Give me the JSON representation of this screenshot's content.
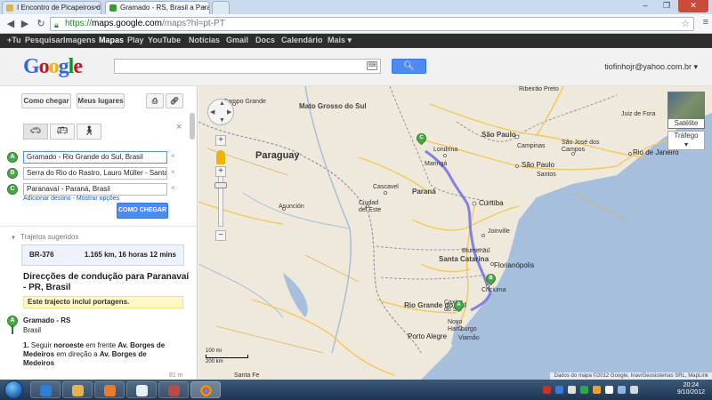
{
  "browser": {
    "tabs": [
      {
        "title": "I Encontro de Picapeiros d",
        "fav_color": "#d9b54a"
      },
      {
        "title": "Gramado - RS, Brasil a Para",
        "fav_color": "#3a9a3a"
      }
    ],
    "url": {
      "scheme": "https://",
      "host": "maps.google.com",
      "path": "/maps?hl=pt-PT"
    }
  },
  "gbar": {
    "items": [
      "+Tu",
      "Pesquisar",
      "Imagens",
      "Mapas",
      "Play",
      "YouTube",
      "Notícias",
      "Gmail",
      "Docs",
      "Calendário",
      "Mais"
    ],
    "active": "Mapas"
  },
  "header": {
    "logo": "Google",
    "search_placeholder": "",
    "user": "tiofinhojr@yahoo.com.br"
  },
  "panel": {
    "get_directions": "Como chegar",
    "my_places": "Meus lugares",
    "waypoints": [
      {
        "letter": "A",
        "value": "Gramado - Rio Grande do Sul, Brasil"
      },
      {
        "letter": "B",
        "value": "Serra do Rio do Rastro, Lauro Müller - Santa C"
      },
      {
        "letter": "C",
        "value": "Paranavaí - Paraná, Brasil"
      }
    ],
    "links": "Adicionar destino - Mostrar opções",
    "go_button": "COMO CHEGAR",
    "suggested_title": "Trajetos sugeridos",
    "route": {
      "road": "BR-376",
      "summary": "1.165 km, 16 horas 12 mins"
    },
    "directions_title": "Direcções de condução para Paranavaí - PR, Brasil",
    "toll_notice": "Este trajecto inclui portagens.",
    "origin": {
      "letter": "A",
      "name": "Gramado - RS",
      "country": "Brasil"
    },
    "step1": {
      "num": "1.",
      "pre": "Seguir ",
      "dir": "noroeste",
      "mid": " em frente ",
      "from": "Av. Borges de Medeiros",
      "mid2": " em direção a ",
      "to": "Av. Borges de Medeiros",
      "dist": "81 m"
    }
  },
  "map": {
    "labels": {
      "mato_grosso": "Mato Grosso do Sul",
      "paraguay": "Paraguay",
      "parana": "Paraná",
      "santa_catarina": "Santa Catarina",
      "rio_grande": "Rio Grande do Sul",
      "sao_paulo_state": "São Paulo",
      "sao_paulo_city": "São Paulo",
      "rio_janeiro": "Rio de Janeiro",
      "curitiba": "Curitiba",
      "londrina": "Londrina",
      "maringa": "Maringá",
      "florianopolis": "Florianópolis",
      "porto_alegre": "Porto Alegre",
      "joinville": "Joinville",
      "blumenau": "Blumenau",
      "campinas": "Campinas",
      "campo_grande": "Campo Grande",
      "asuncion": "Asunción",
      "ciudad_este": "Ciudad del Este",
      "criciuma": "Criciúma",
      "ribeirao": "Ribeirão Preto",
      "juiz_fora": "Juiz de Fora",
      "sao_jose": "São José dos Campos",
      "santos": "Santos",
      "cascavel": "Cascavel",
      "caxias": "Caxias do Sul",
      "novo_hamburgo": "Novo Hamburgo",
      "viamao": "Viamão",
      "santa_fe": "Santa Fe"
    },
    "controls": {
      "satellite": "Satélite",
      "traffic": "Tráfego"
    },
    "scale": {
      "top": "100 mi",
      "bottom": "200 km"
    },
    "copyright": "Dados do mapa ©2012 Google, Inav/Geosistemas SRL, MapLink",
    "markers": [
      "A",
      "B",
      "C"
    ],
    "colors": {
      "land": "#efe9dc",
      "water": "#a5bfdd",
      "route": "#6f6fe6",
      "road": "#f2c85a",
      "border": "#9b8fa8"
    }
  },
  "taskbar": {
    "time": "20:24",
    "date": "9/10/2012"
  }
}
